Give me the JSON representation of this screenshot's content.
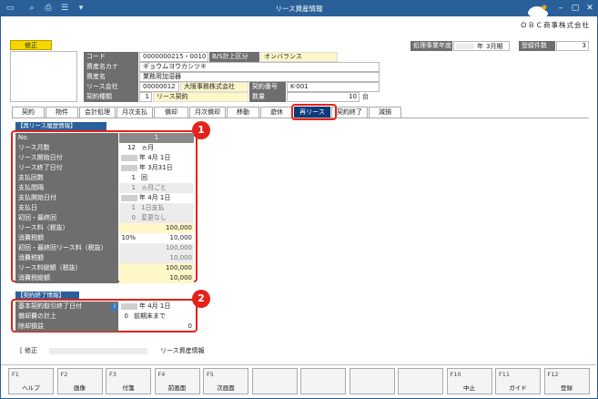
{
  "window": {
    "title": "リース資産情報",
    "company": "ＯＢＣ商事株式会社"
  },
  "mode_badge": "修正",
  "header": {
    "fiscal_label": "処理事業年度",
    "fiscal_year_suffix": "年",
    "fiscal_month": "3月期",
    "count_label": "登録件数",
    "count_value": "3"
  },
  "asset": {
    "code_label": "コード",
    "code_value": "0000000215・0010",
    "bs_label": "B/S計上区分",
    "bs_value": "オンバランス",
    "kana_label": "資産名カナ",
    "kana_value": "ギョウムヨウカシツキ",
    "name_label": "資産名",
    "name_value": "業務用加湿器",
    "lease_co_label": "リース会社",
    "lease_co_code": "00000012",
    "lease_co_name": "大阪事務株式会社",
    "contract_no_label": "契約番号",
    "contract_no_value": "K-001",
    "contract_type_label": "契約種類",
    "contract_type_code": "1",
    "contract_type_name": "リース契約",
    "qty_label": "数量",
    "qty_value": "10",
    "qty_unit": "台"
  },
  "tabs": [
    "契約",
    "物件",
    "会計処理",
    "月次支払",
    "償却",
    "月次償却",
    "移動",
    "遊休",
    "再リース",
    "契約終了",
    "減損"
  ],
  "active_tab": "再リース",
  "release": {
    "section_title": "【再リース履歴情報】",
    "no_label": "No.",
    "no_value": "1",
    "rows": [
      {
        "label": "リース月数",
        "value": "12",
        "extra": "ヵ月"
      },
      {
        "label": "リース開始日付",
        "value": "年  4月  1日"
      },
      {
        "label": "リース終了日付",
        "value": "年  3月31日"
      },
      {
        "label": "支払回数",
        "value": "1",
        "extra": "回"
      },
      {
        "label": "支払間隔",
        "value": "1",
        "extra": "ヵ月ごと"
      },
      {
        "label": "支払開始日付",
        "value": "年  4月  1日"
      },
      {
        "label": "支払日",
        "value": "1",
        "extra": "1日支払"
      },
      {
        "label": "初回・最終回",
        "value": "0",
        "extra": "変更なし"
      },
      {
        "label": "リース料（税抜）",
        "value": "100,000"
      },
      {
        "label": "消費税額",
        "value": "10%",
        "extra": "10,000"
      },
      {
        "label": "初回・最終回リース料（税抜）",
        "value": "100,000"
      },
      {
        "label": "消費税額",
        "value": "10,000"
      },
      {
        "label": "リース料総額（税抜）",
        "value": "100,000"
      },
      {
        "label": "消費税総額",
        "value": "10,000"
      }
    ]
  },
  "termination": {
    "section_title": "【契約終了情報】",
    "rows": [
      {
        "label": "基本契約取引終了日付",
        "value": "年  4月  1日"
      },
      {
        "label": "償却費の計上",
        "value": "0",
        "extra": "前期末まで"
      },
      {
        "label": "除却損益",
        "value": "0"
      }
    ]
  },
  "callouts": [
    "1",
    "2"
  ],
  "statusbar": {
    "prefix": "[ 修正",
    "text": "リース資産情報"
  },
  "fkeys": [
    {
      "key": "F1",
      "label": "ヘルプ"
    },
    {
      "key": "F2",
      "label": "画像"
    },
    {
      "key": "F3",
      "label": "付箋"
    },
    {
      "key": "F4",
      "label": "前画面"
    },
    {
      "key": "F5",
      "label": "次画面"
    },
    {
      "key": "",
      "label": ""
    },
    {
      "key": "",
      "label": ""
    },
    {
      "key": "",
      "label": ""
    },
    {
      "key": "",
      "label": ""
    },
    {
      "key": "F10",
      "label": "中止"
    },
    {
      "key": "F11",
      "label": "ガイド"
    },
    {
      "key": "F12",
      "label": "登録"
    }
  ],
  "colors": {
    "title_bar": "#2a6099",
    "highlight": "#e3221b",
    "active_tab": "#0f3a7a"
  }
}
